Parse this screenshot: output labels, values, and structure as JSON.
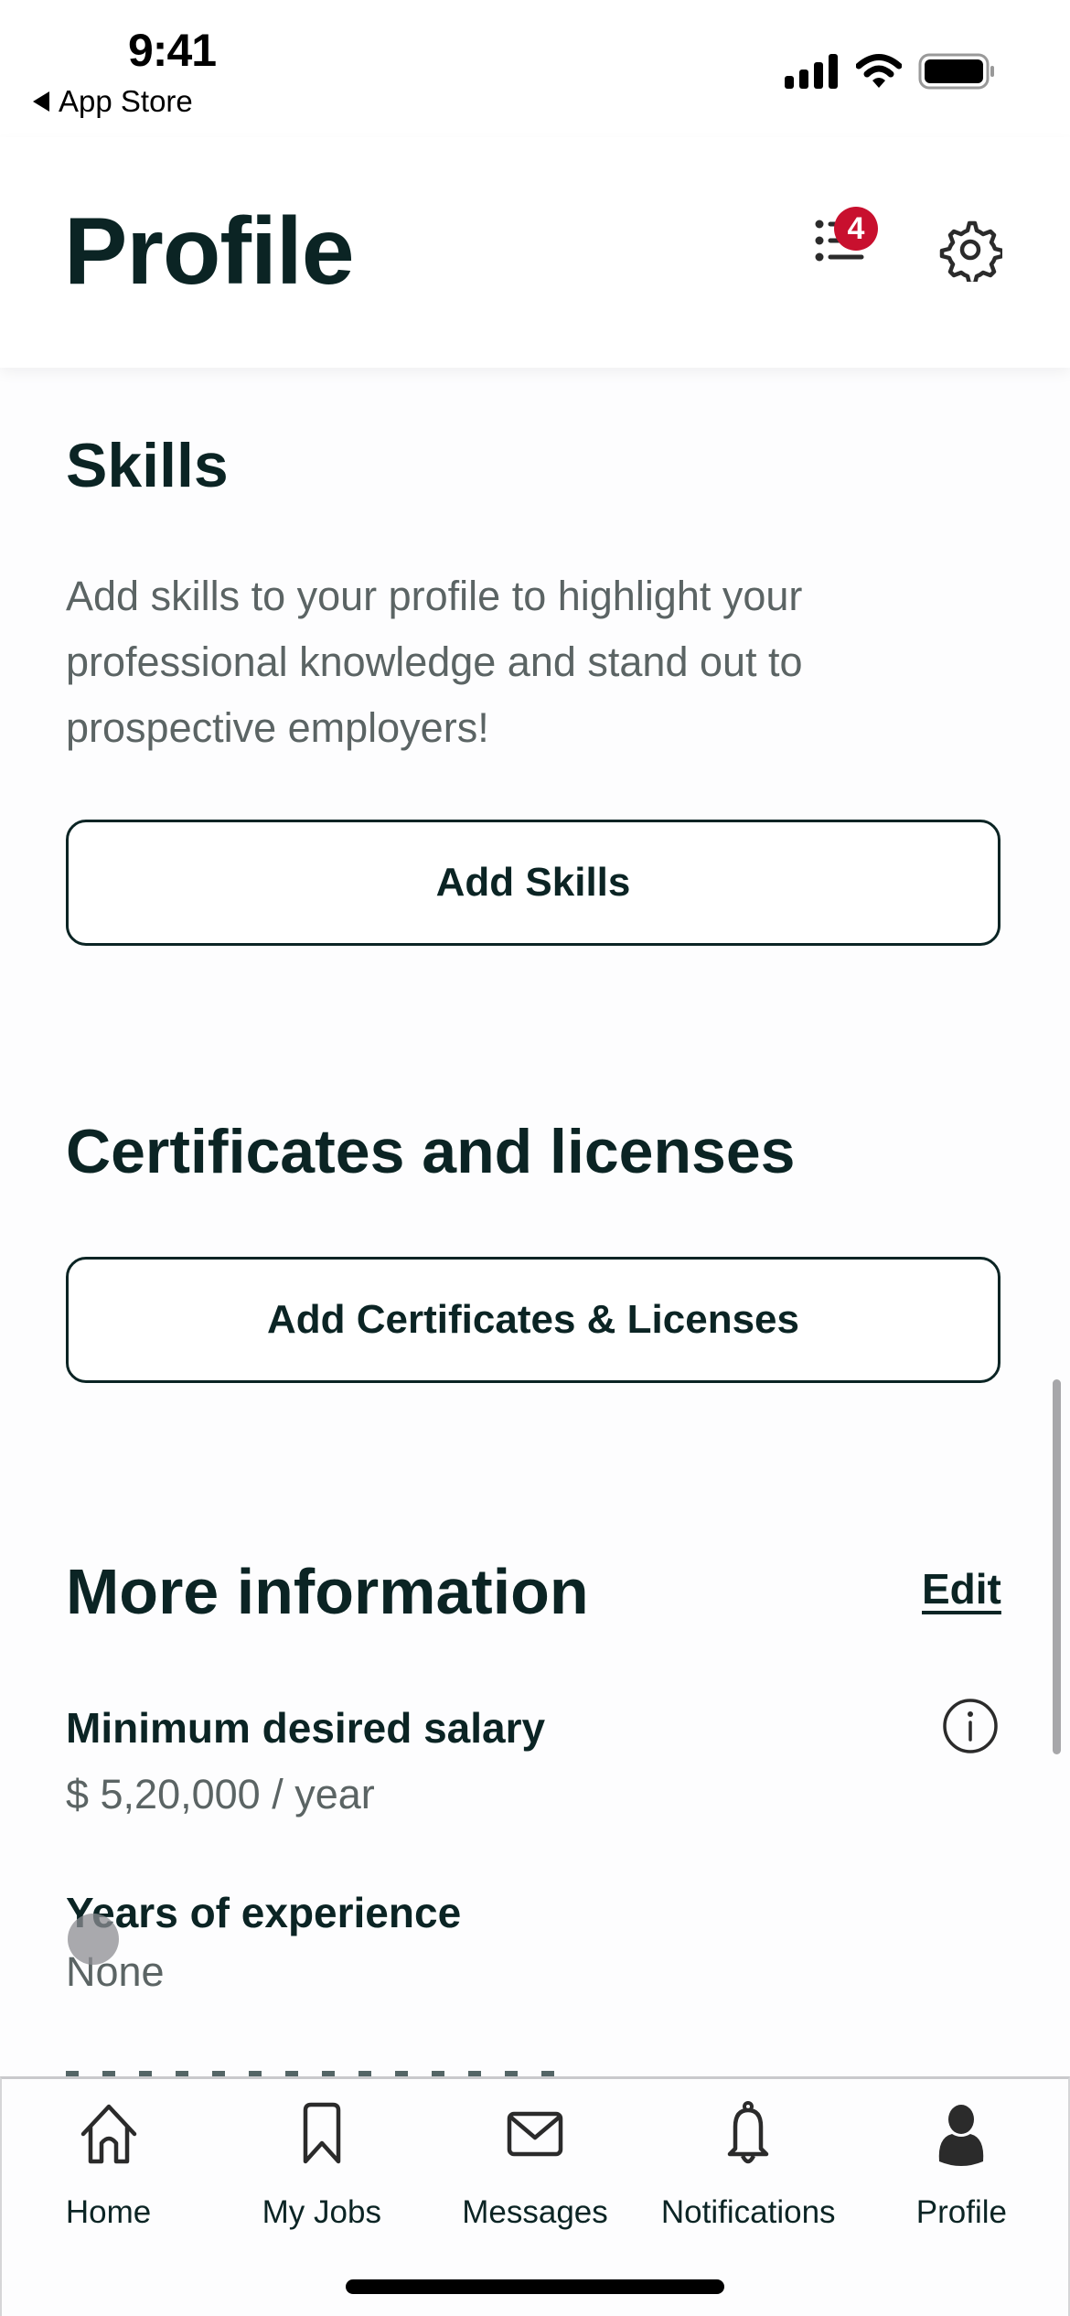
{
  "status_bar": {
    "time": "9:41",
    "back_app": "App Store",
    "icons": [
      "cellular-signal-icon",
      "wifi-icon",
      "battery-icon"
    ]
  },
  "header": {
    "title": "Profile",
    "checklist_badge_count": "4",
    "icons": [
      "checklist-icon",
      "gear-icon"
    ],
    "badge_color": "#c8102e"
  },
  "skills": {
    "title": "Skills",
    "description": "Add skills to your profile to highlight your professional knowledge and stand out to prospective employers!",
    "button_label": "Add Skills"
  },
  "certificates": {
    "title": "Certificates and licenses",
    "button_label": "Add Certificates & Licenses"
  },
  "more_information": {
    "title": "More information",
    "edit_label": "Edit",
    "fields": [
      {
        "label": "Minimum desired salary",
        "value": "$ 5,20,000 / year",
        "icon": "info-icon"
      },
      {
        "label": "Years of experience",
        "value": "None"
      }
    ]
  },
  "tab_bar": {
    "items": [
      {
        "label": "Home",
        "icon": "home-icon",
        "active": false
      },
      {
        "label": "My Jobs",
        "icon": "bookmark-icon",
        "active": false
      },
      {
        "label": "Messages",
        "icon": "envelope-icon",
        "active": false
      },
      {
        "label": "Notifications",
        "icon": "bell-icon",
        "active": false
      },
      {
        "label": "Profile",
        "icon": "person-icon",
        "active": true
      }
    ]
  },
  "colors": {
    "text_primary": "#0b2424",
    "text_secondary": "#5b6464",
    "badge": "#c8102e"
  }
}
